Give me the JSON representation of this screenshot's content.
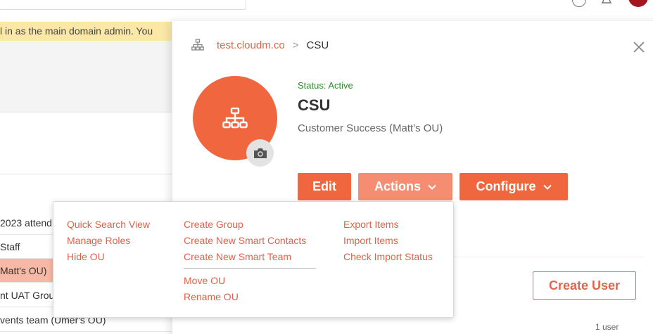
{
  "background": {
    "notice_text": "l in as the main domain admin. You",
    "rows": [
      "2023 attend",
      "Staff",
      "Matt's OU)",
      "nt UAT Grou",
      "vents team (Umer's OU)"
    ]
  },
  "breadcrumb": {
    "root": "test.cloudm.co",
    "separator": ">",
    "current": "CSU"
  },
  "ou": {
    "status": "Status: Active",
    "name": "CSU",
    "description": "Customer Success (Matt's OU)"
  },
  "buttons": {
    "edit": "Edit",
    "actions": "Actions",
    "configure": "Configure",
    "create_user": "Create User"
  },
  "user_count": "1 user",
  "actions_menu": {
    "col1": [
      "Quick Search View",
      "Manage Roles",
      "Hide OU"
    ],
    "col2_top": [
      "Create Group",
      "Create New Smart Contacts",
      "Create New Smart Team"
    ],
    "col2_bottom": [
      "Move OU",
      "Rename OU"
    ],
    "col3": [
      "Export Items",
      "Import Items",
      "Check Import Status"
    ]
  },
  "colors": {
    "brand": "#f0673f",
    "brand_light": "#f58d72",
    "link": "#e0674a",
    "status_active": "#2e8b2e",
    "notice": "#fbe7a6",
    "selected_row": "#f7b9a5"
  }
}
